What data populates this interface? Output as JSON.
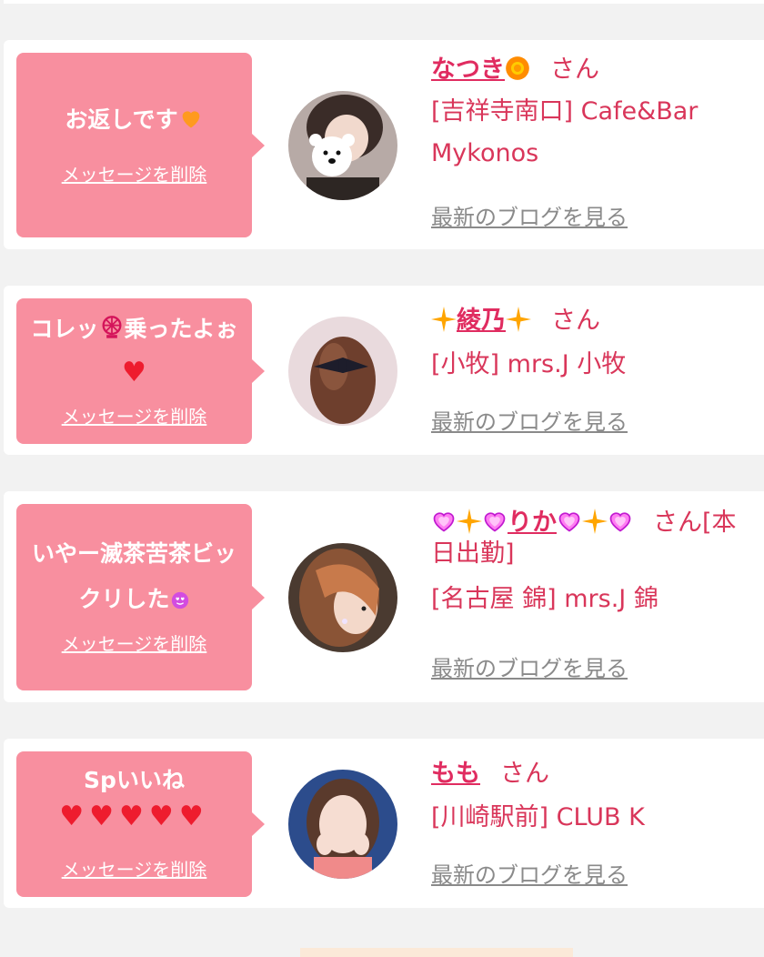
{
  "colors": {
    "bubble": "#f88f9f",
    "name": "#e02c60",
    "text_pink": "#d9365a",
    "link_gray": "#8a8a8a"
  },
  "cards": [
    {
      "message": "お返しです",
      "message_icon": "orange-heart-icon",
      "delete_label": "メッセージを削除",
      "name": "なつき",
      "name_icon": "sun-flower-icon",
      "honorific": "さん",
      "shop": "[吉祥寺南口] Cafe&Bar Mykonos",
      "blog_label": "最新のブログを見る"
    },
    {
      "message_a": "コレッ",
      "message_icon": "ferris-wheel-icon",
      "message_b": "乗ったよぉ",
      "message_heart": "♥",
      "delete_label": "メッセージを削除",
      "name": "綾乃",
      "name_icon": "sparkle-star-icon",
      "honorific": "さん",
      "shop": "[小牧] mrs.J 小牧",
      "blog_label": "最新のブログを見る"
    },
    {
      "message": "いやー滅茶苦茶ビックリした",
      "message_icon": "heart-eyes-icon",
      "delete_label": "メッセージを削除",
      "name": "りか",
      "name_icons": "sparkling-heart-icon, sparkle-star-icon",
      "honorific": "さん",
      "status": "[本日出勤]",
      "shop": "[名古屋 錦] mrs.J 錦",
      "blog_label": "最新のブログを見る"
    },
    {
      "message": "Spいいね",
      "message_hearts": "♥♥♥♥♥",
      "delete_label": "メッセージを削除",
      "name": "もも",
      "honorific": "さん",
      "shop": "[川崎駅前] CLUB K",
      "blog_label": "最新のブログを見る"
    }
  ]
}
